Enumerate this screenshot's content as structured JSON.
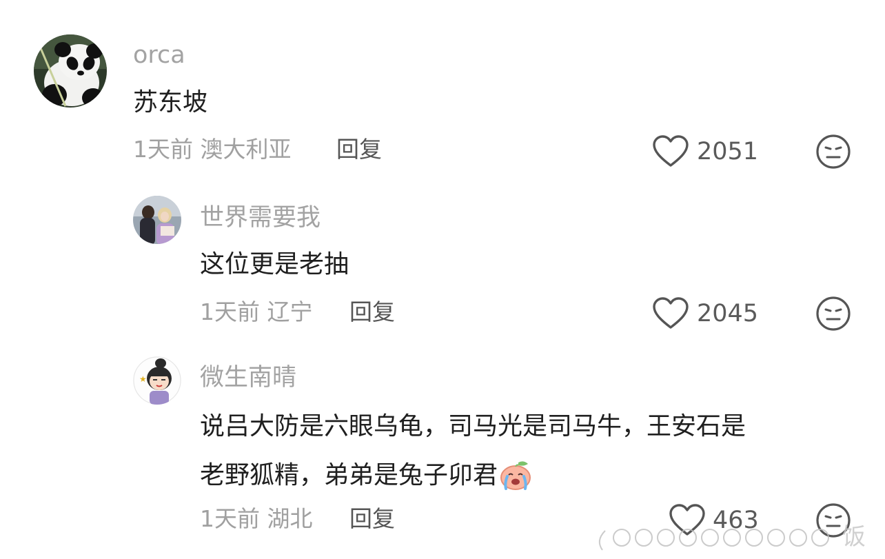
{
  "comments": [
    {
      "username": "orca",
      "content_lines": [
        "苏东坡"
      ],
      "time": "1天前",
      "location": "澳大利亚",
      "reply_label": "回复",
      "likes": "2051"
    },
    {
      "username": "世界需要我",
      "content_lines": [
        "这位更是老抽"
      ],
      "time": "1天前",
      "location": "辽宁",
      "reply_label": "回复",
      "likes": "2045"
    },
    {
      "username": "微生南晴",
      "content_lines": [
        "说吕大防是六眼乌龟，司马光是司马牛，王安石是",
        "老野狐精，弟弟是兔子卯君"
      ],
      "emoji": "crying-peach-emoji",
      "time": "1天前",
      "location": "湖北",
      "reply_label": "回复",
      "likes": "463"
    }
  ],
  "watermark": {
    "text": "饭"
  },
  "colors": {
    "username": "#a3a3a3",
    "content": "#1f1f1f",
    "meta": "#a0a0a0",
    "reply": "#555555",
    "icon": "#555555"
  }
}
